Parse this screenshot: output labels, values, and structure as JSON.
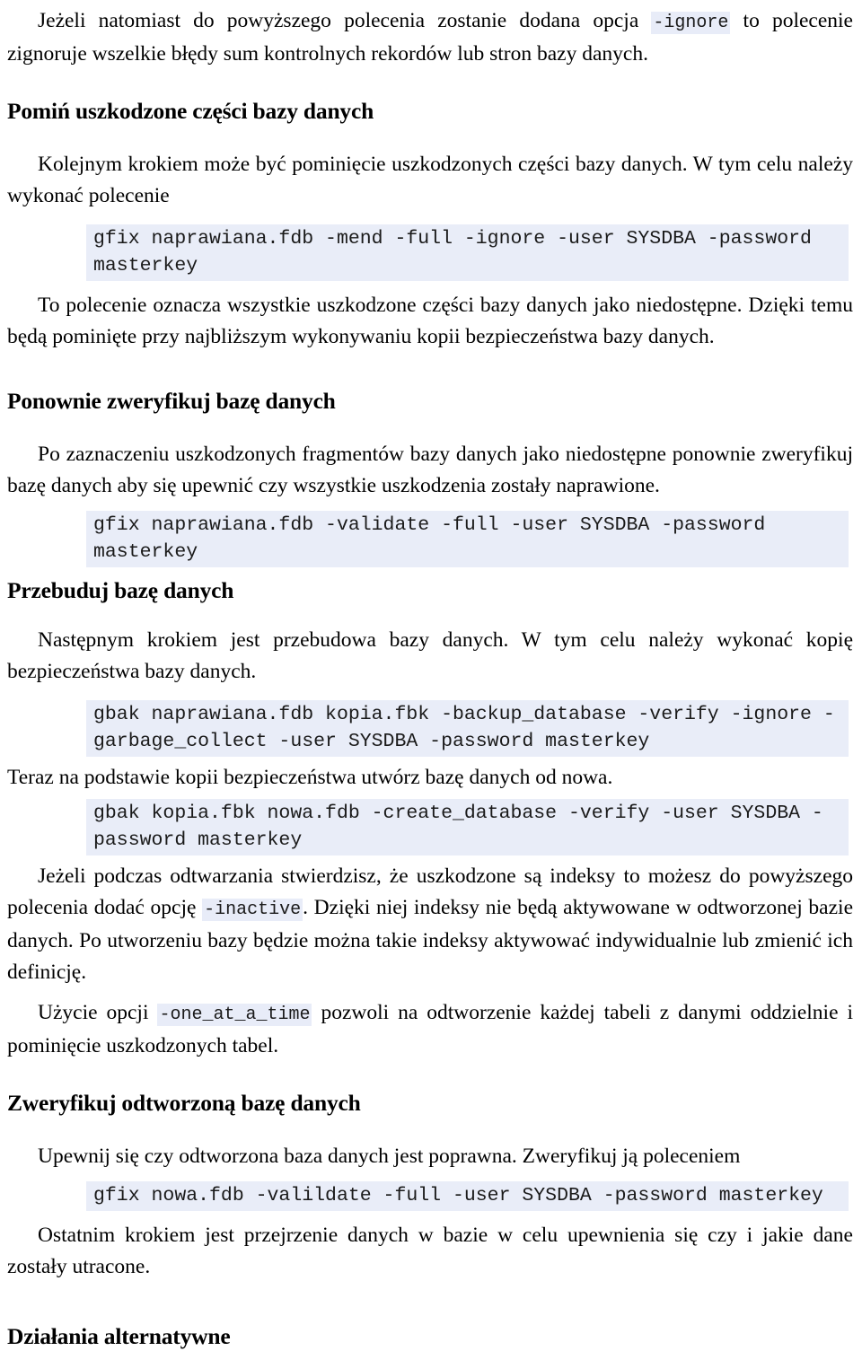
{
  "document": {
    "language": "pl",
    "colors": {
      "code_background": "#e9edf8",
      "inline_code_background": "#e8ecf8",
      "text": "#000000"
    }
  },
  "blocks": {
    "intro_paragraph": {
      "before_code": "Jeżeli natomiast do powyższego polecenia zostanie dodana opcja ",
      "inline_code": "-ignore",
      "after_code": " to polecenie zignoruje wszelkie błędy sum kontrolnych rekordów lub stron bazy danych."
    },
    "section_skip": {
      "heading": "Pomiń uszkodzone części bazy danych",
      "paragraph": "Kolejnym krokiem może być pominięcie uszkodzonych części bazy danych. W tym celu należy wykonać polecenie",
      "code": "gfix naprawiana.fdb -mend -full -ignore -user SYSDBA -password masterkey",
      "paragraph_after": "To polecenie oznacza wszystkie uszkodzone części bazy danych jako niedostępne. Dzięki temu będą pominięte przy najbliższym wykonywaniu kopii bezpieczeństwa bazy danych."
    },
    "section_reverify": {
      "heading": "Ponownie zweryfikuj bazę danych",
      "paragraph": "Po zaznaczeniu uszkodzonych fragmentów bazy danych jako niedostępne ponownie zweryfikuj bazę danych aby się upewnić czy wszystkie uszkodzenia zostały naprawione.",
      "code": "gfix naprawiana.fdb -validate -full -user SYSDBA -password masterkey"
    },
    "section_rebuild": {
      "heading": "Przebuduj bazę danych",
      "paragraph": "Następnym krokiem jest przebudowa bazy danych. W tym celu należy wykonać kopię bezpieczeństwa bazy danych.",
      "code_backup": "gbak naprawiana.fdb kopia.fbk -backup_database -verify -ignore -garbage_collect -user SYSDBA -password masterkey",
      "paragraph_restore": "Teraz na podstawie kopii bezpieczeństwa utwórz bazę danych od nowa.",
      "code_restore": "gbak kopia.fbk nowa.fdb -create_database -verify -user SYSDBA -password masterkey",
      "paragraph_inactive_before": "Jeżeli podczas odtwarzania stwierdzisz, że uszkodzone są indeksy to możesz do powyższego polecenia dodać opcję ",
      "paragraph_inactive_code": "-inactive",
      "paragraph_inactive_after": ". Dzięki niej indeksy nie będą aktywowane w odtworzonej bazie danych. Po utworzeniu bazy będzie można takie indeksy aktywować indywidualnie lub zmienić ich definicję.",
      "paragraph_one_at_a_time_before": "Użycie opcji ",
      "paragraph_one_at_a_time_code": "-one_at_a_time",
      "paragraph_one_at_a_time_after": " pozwoli na odtworzenie każdej tabeli z danymi oddzielnie i pominięcie uszkodzonych tabel."
    },
    "section_verify_restored": {
      "heading": "Zweryfikuj odtworzoną bazę danych",
      "paragraph": "Upewnij się czy odtworzona baza danych jest poprawna. Zweryfikuj ją poleceniem",
      "code": "gfix nowa.fdb -valildate -full -user SYSDBA -password masterkey",
      "paragraph_after": "Ostatnim krokiem jest przejrzenie danych w bazie w celu upewnienia się czy i jakie dane zostały utracone."
    },
    "section_alternatives": {
      "heading": "Działania alternatywne"
    }
  }
}
